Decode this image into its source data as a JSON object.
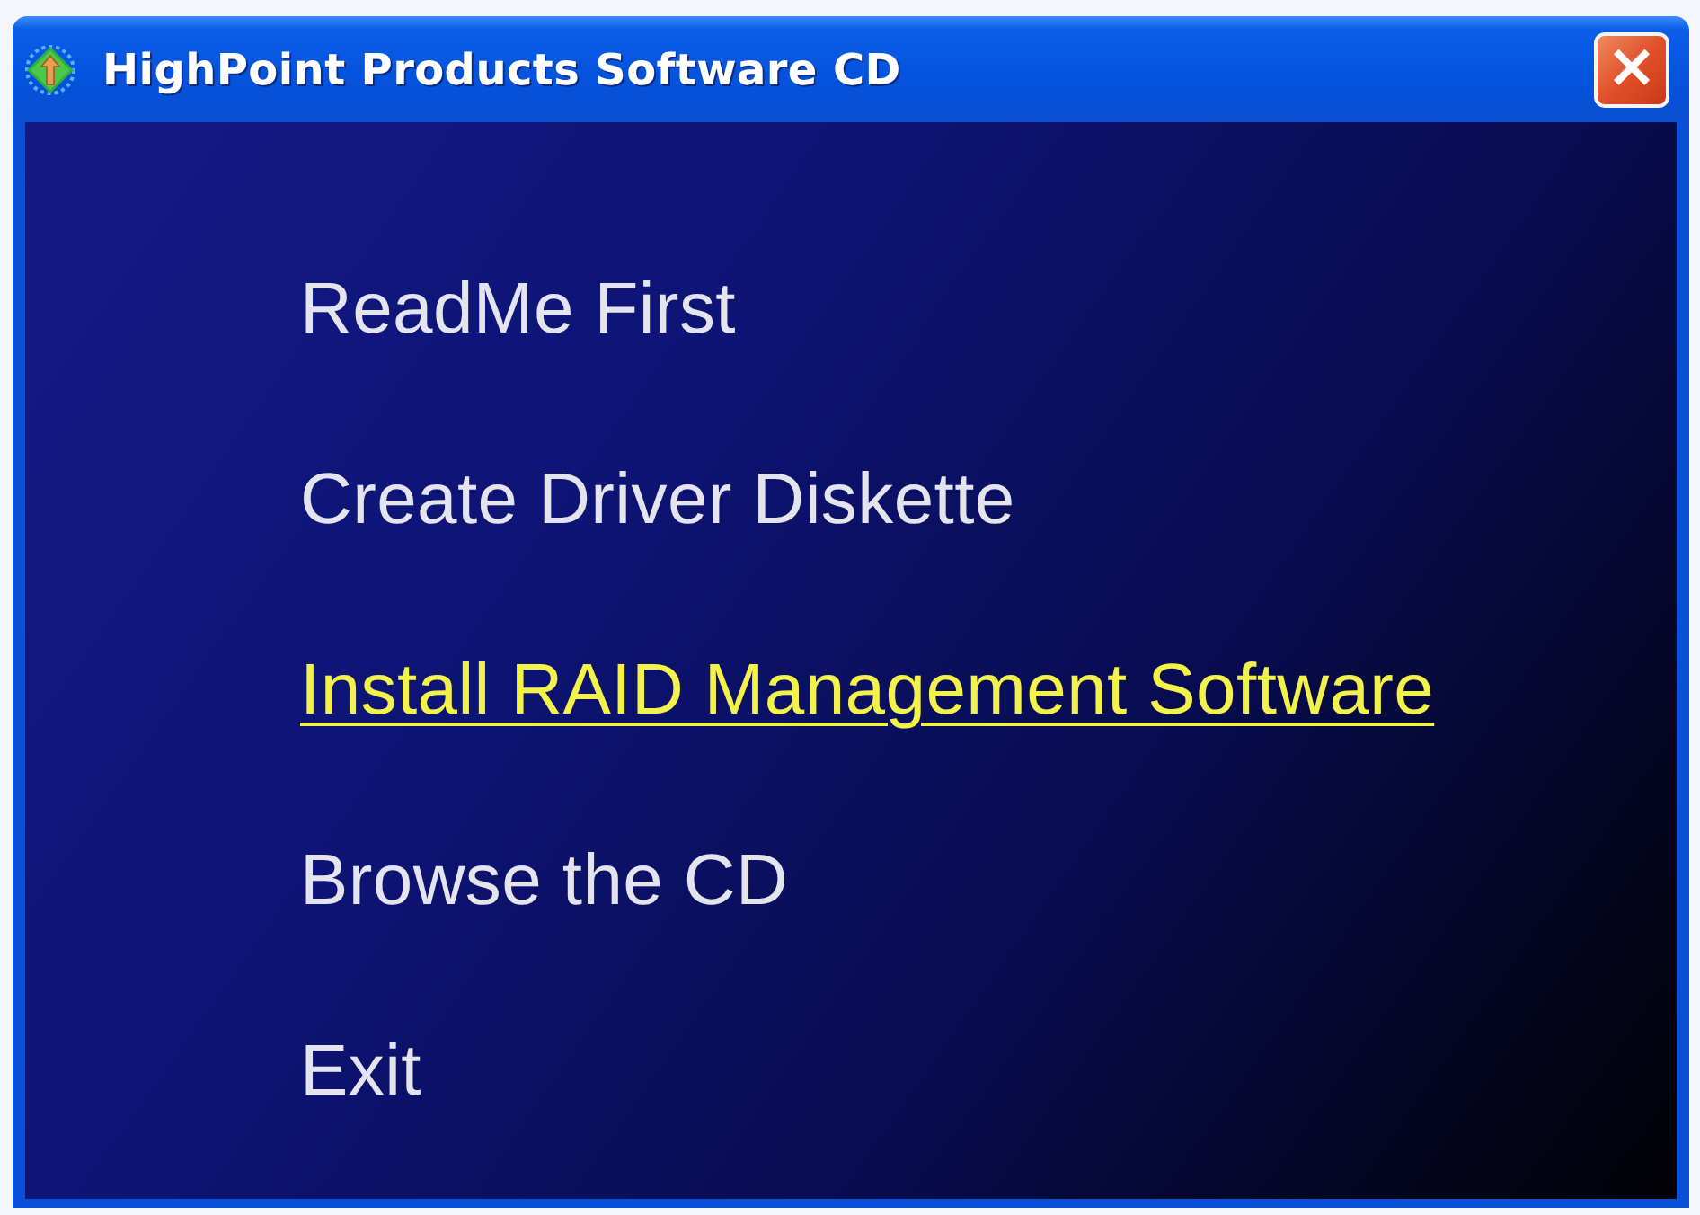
{
  "window": {
    "title": "HighPoint Products Software CD",
    "close": "×"
  },
  "menu": [
    {
      "label": "ReadMe First",
      "selected": false
    },
    {
      "label": "Create Driver Diskette",
      "selected": false
    },
    {
      "label": "Install RAID Management Software",
      "selected": true
    },
    {
      "label": "Browse the CD",
      "selected": false
    },
    {
      "label": "Exit",
      "selected": false
    }
  ]
}
